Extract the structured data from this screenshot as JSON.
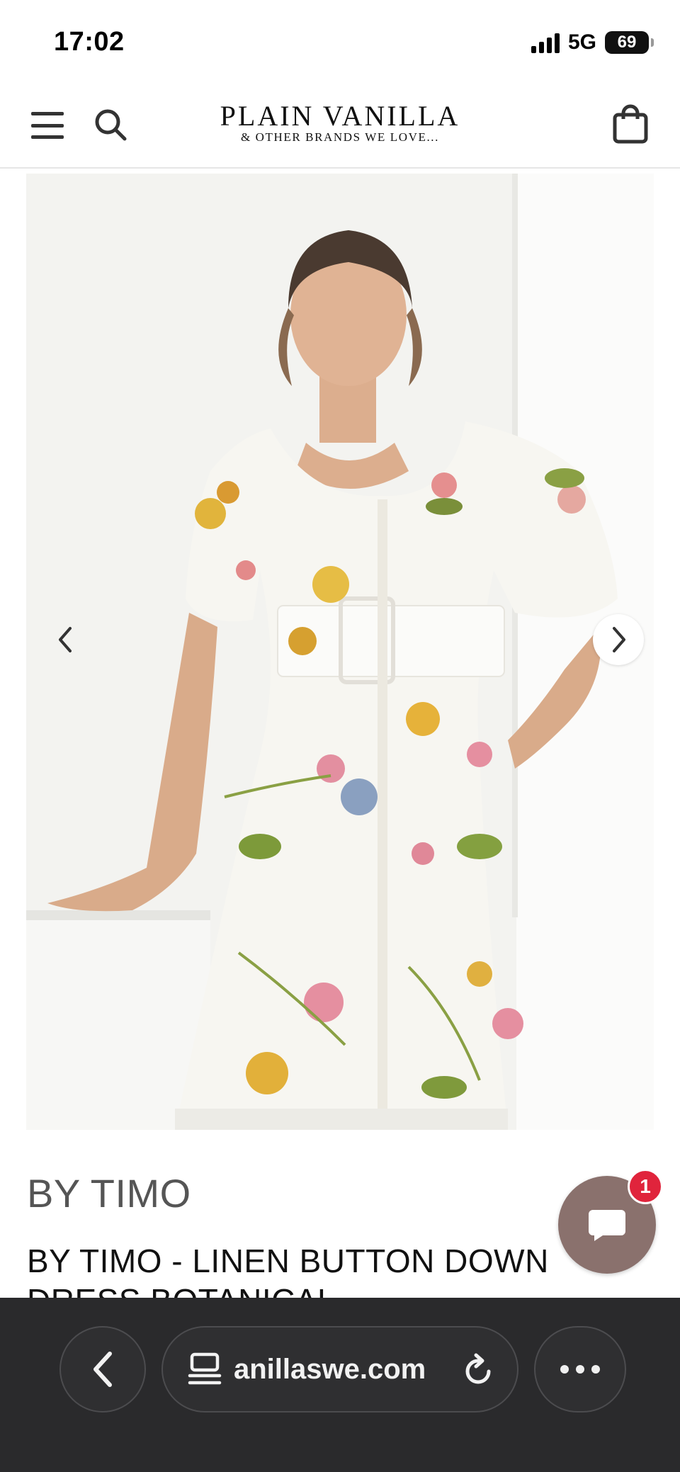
{
  "status_bar": {
    "time": "17:02",
    "network": "5G",
    "battery": "69"
  },
  "header": {
    "logo_main": "PLAIN VANILLA",
    "logo_sub": "& OTHER BRANDS WE LOVE...",
    "icons": [
      "menu-icon",
      "search-icon",
      "shopping-bag-icon"
    ]
  },
  "product": {
    "brand": "BY TIMO",
    "title": "BY TIMO - LINEN BUTTON DOWN DRESS BOTANICAL",
    "image_nav": [
      "chevron-left-icon",
      "chevron-right-icon"
    ]
  },
  "chat": {
    "badge_count": "1",
    "chat_color": "#8a716d",
    "badge_color": "#e0243c"
  },
  "browser": {
    "url": "anillaswe.com",
    "icons": [
      "back-icon",
      "tabs-icon",
      "reload-icon",
      "more-icon"
    ],
    "toolbar_color": "#2a2a2c"
  }
}
